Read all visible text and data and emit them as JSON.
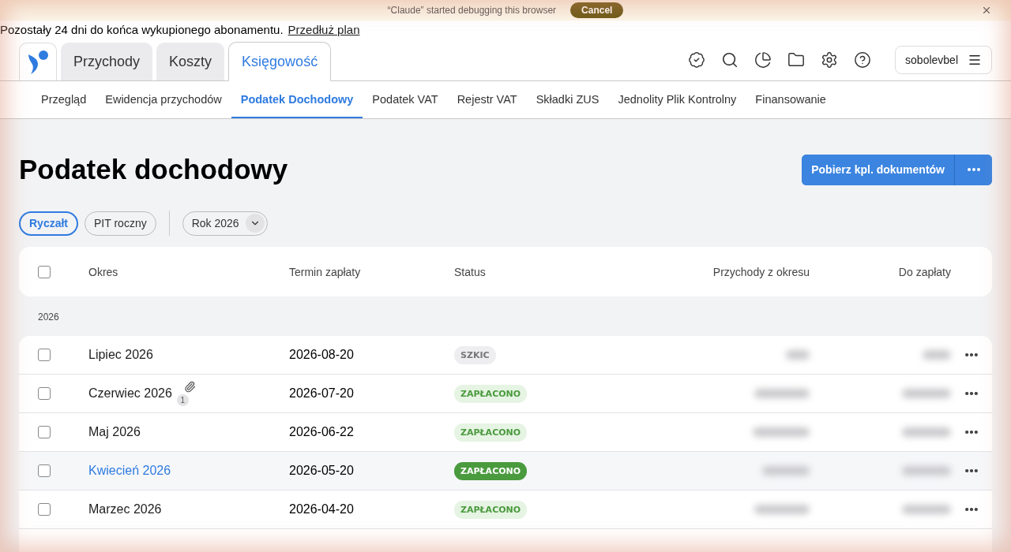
{
  "browser_banner": {
    "message": "“Claude” started debugging this browser",
    "button": "Cancel"
  },
  "subscription_notice": {
    "text": "Pozostały 24 dni do końca wykupionego abonamentu.",
    "link": "Przedłuż plan"
  },
  "main_tabs": [
    {
      "label": "Przychody",
      "selected": false
    },
    {
      "label": "Koszty",
      "selected": false
    },
    {
      "label": "Księgowość",
      "selected": true
    }
  ],
  "user_menu": {
    "username": "sobolevbel"
  },
  "sub_tabs": [
    {
      "label": "Przegląd",
      "selected": false
    },
    {
      "label": "Ewidencja przychodów",
      "selected": false
    },
    {
      "label": "Podatek Dochodowy",
      "selected": true
    },
    {
      "label": "Podatek VAT",
      "selected": false
    },
    {
      "label": "Rejestr VAT",
      "selected": false
    },
    {
      "label": "Składki ZUS",
      "selected": false
    },
    {
      "label": "Jednolity Plik Kontrolny",
      "selected": false
    },
    {
      "label": "Finansowanie",
      "selected": false
    }
  ],
  "page_title": "Podatek dochodowy",
  "download_button": "Pobierz kpl. dokumentów",
  "filters": [
    {
      "label": "Ryczałt",
      "selected": true
    },
    {
      "label": "PIT roczny",
      "selected": false
    }
  ],
  "year_select": {
    "value": "Rok 2026"
  },
  "table": {
    "columns": [
      "Okres",
      "Termin zapłaty",
      "Status",
      "Przychody z okresu",
      "Do zapłaty"
    ],
    "select_all_checked": false,
    "group": "2026",
    "rows": [
      {
        "period": "Lipiec 2026",
        "attachments": null,
        "due": "2026-08-20",
        "status": "SZKIC",
        "kind": "draft",
        "selected": false,
        "checked": false
      },
      {
        "period": "Czerwiec 2026",
        "attachments": "1",
        "due": "2026-07-20",
        "status": "ZAPŁACONO",
        "kind": "paid",
        "selected": false,
        "checked": false
      },
      {
        "period": "Maj 2026",
        "attachments": null,
        "due": "2026-06-22",
        "status": "ZAPŁACONO",
        "kind": "paid",
        "selected": false,
        "checked": false
      },
      {
        "period": "Kwiecień 2026",
        "attachments": null,
        "due": "2026-05-20",
        "status": "ZAPŁACONO",
        "kind": "paid",
        "selected": true,
        "checked": false
      },
      {
        "period": "Marzec 2026",
        "attachments": null,
        "due": "2026-04-20",
        "status": "ZAPŁACONO",
        "kind": "paid",
        "selected": false,
        "checked": false
      }
    ]
  }
}
